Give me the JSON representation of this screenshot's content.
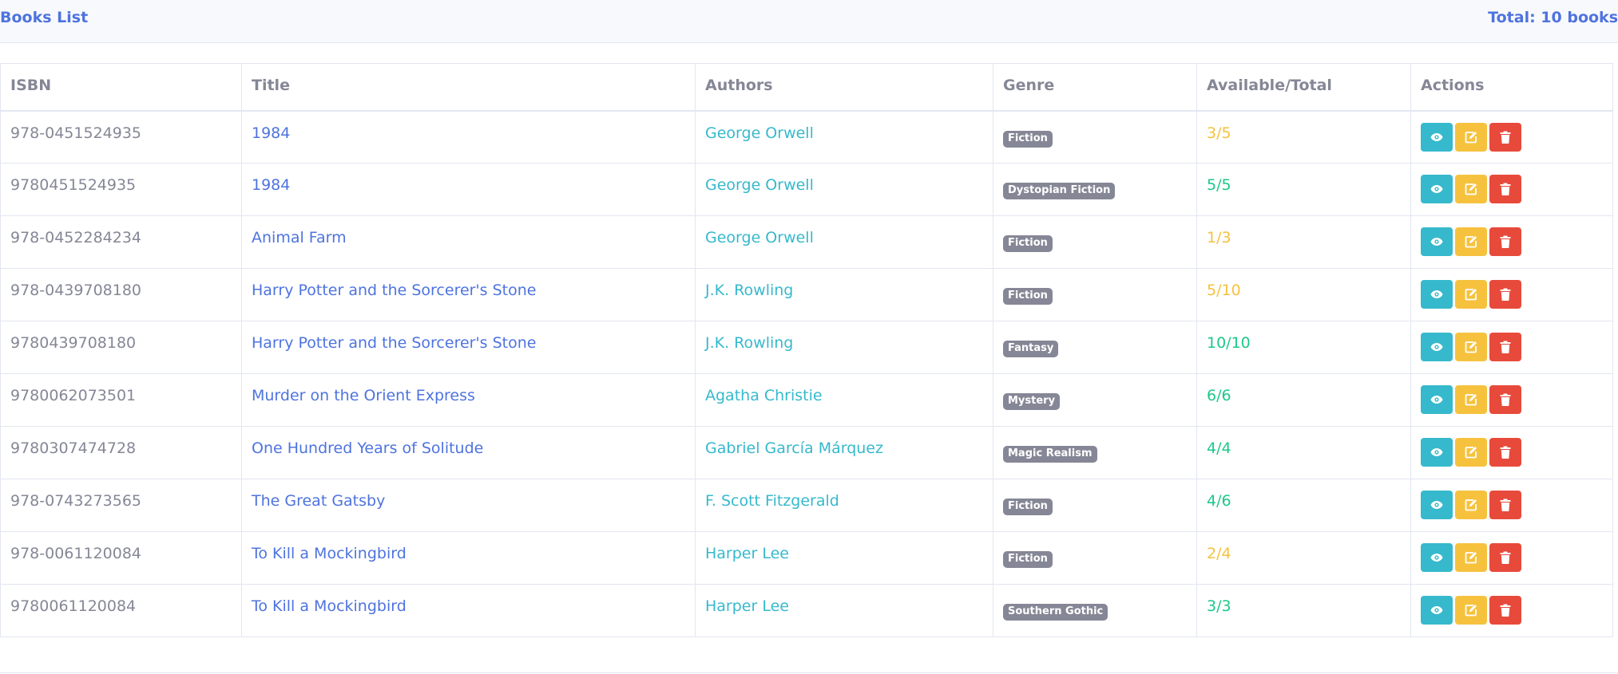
{
  "header": {
    "title": "Books List",
    "total": "Total: 10 books"
  },
  "table": {
    "columns": [
      "ISBN",
      "Title",
      "Authors",
      "Genre",
      "Available/Total",
      "Actions"
    ],
    "rows": [
      {
        "isbn": "978-0451524935",
        "title": "1984",
        "authors": "George Orwell",
        "genre": "Fiction",
        "availability": "3/5"
      },
      {
        "isbn": "9780451524935",
        "title": "1984",
        "authors": "George Orwell",
        "genre": "Dystopian Fiction",
        "availability": "5/5"
      },
      {
        "isbn": "978-0452284234",
        "title": "Animal Farm",
        "authors": "George Orwell",
        "genre": "Fiction",
        "availability": "1/3"
      },
      {
        "isbn": "978-0439708180",
        "title": "Harry Potter and the Sorcerer's Stone",
        "authors": "J.K. Rowling",
        "genre": "Fiction",
        "availability": "5/10"
      },
      {
        "isbn": "9780439708180",
        "title": "Harry Potter and the Sorcerer's Stone",
        "authors": "J.K. Rowling",
        "genre": "Fantasy",
        "availability": "10/10"
      },
      {
        "isbn": "9780062073501",
        "title": "Murder on the Orient Express",
        "authors": "Agatha Christie",
        "genre": "Mystery",
        "availability": "6/6"
      },
      {
        "isbn": "9780307474728",
        "title": "One Hundred Years of Solitude",
        "authors": "Gabriel García Márquez",
        "genre": "Magic Realism",
        "availability": "4/4"
      },
      {
        "isbn": "978-0743273565",
        "title": "The Great Gatsby",
        "authors": "F. Scott Fitzgerald",
        "genre": "Fiction",
        "availability": "4/6"
      },
      {
        "isbn": "978-0061120084",
        "title": "To Kill a Mockingbird",
        "authors": "Harper Lee",
        "genre": "Fiction",
        "availability": "2/4"
      },
      {
        "isbn": "9780061120084",
        "title": "To Kill a Mockingbird",
        "authors": "Harper Lee",
        "genre": "Southern Gothic",
        "availability": "3/3"
      }
    ],
    "actions": [
      {
        "name": "view",
        "icon": "eye-icon",
        "color": "#36b9cc"
      },
      {
        "name": "edit",
        "icon": "edit-icon",
        "color": "#f6c23e"
      },
      {
        "name": "delete",
        "icon": "trash-icon",
        "color": "#e74a3b"
      }
    ]
  },
  "colors": {
    "primary": "#4e73df",
    "info": "#36b9cc",
    "warning": "#f6c23e",
    "success": "#1cc88a",
    "danger": "#e74a3b",
    "secondary": "#858796"
  }
}
